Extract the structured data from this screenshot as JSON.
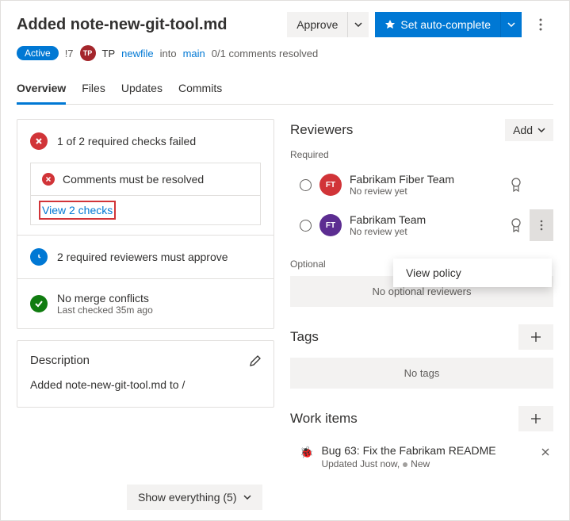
{
  "header": {
    "title": "Added note-new-git-tool.md",
    "approve": "Approve",
    "autocomplete": "Set auto-complete"
  },
  "meta": {
    "status": "Active",
    "pr_id": "!7",
    "avatar_initials": "TP",
    "author": "TP",
    "source_branch": "newfile",
    "into": "into",
    "target_branch": "main",
    "comments": "0/1 comments resolved"
  },
  "tabs": [
    "Overview",
    "Files",
    "Updates",
    "Commits"
  ],
  "checks": {
    "summary": "1 of 2 required checks failed",
    "comment_check": "Comments must be resolved",
    "view_link": "View 2 checks",
    "reviewers_check": "2 required reviewers must approve",
    "merge_title": "No merge conflicts",
    "merge_sub": "Last checked 35m ago"
  },
  "description": {
    "heading": "Description",
    "body": "Added note-new-git-tool.md to /"
  },
  "reviewers": {
    "heading": "Reviewers",
    "add": "Add",
    "required_label": "Required",
    "optional_label": "Optional",
    "no_optional": "No optional reviewers",
    "items": [
      {
        "name": "Fabrikam Fiber Team",
        "status": "No review yet",
        "initials": "FT",
        "color": "#d13438"
      },
      {
        "name": "Fabrikam Team",
        "status": "No review yet",
        "initials": "FT",
        "color": "#5c2d91"
      }
    ]
  },
  "popup": {
    "view_policy": "View policy"
  },
  "tags": {
    "heading": "Tags",
    "empty": "No tags"
  },
  "work_items": {
    "heading": "Work items",
    "item": {
      "title": "Bug 63: Fix the Fabrikam README",
      "sub_prefix": "Updated Just now,",
      "state": "New"
    }
  },
  "footer": {
    "show": "Show everything (5)"
  }
}
